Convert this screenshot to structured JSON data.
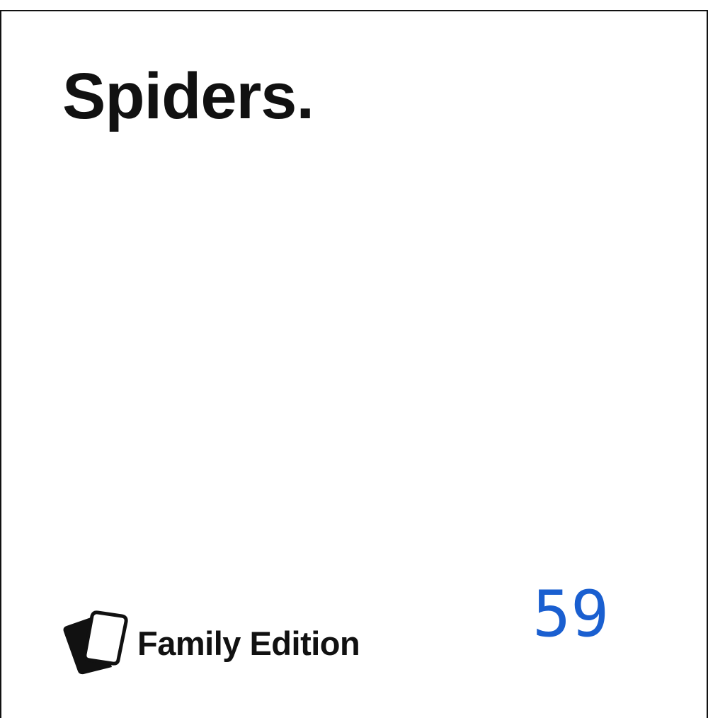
{
  "card": {
    "prompt": "Spiders.",
    "brand": {
      "name": "Family Edition",
      "logo_icon": "cards-stack-icon"
    },
    "number": "59",
    "colors": {
      "text": "#111111",
      "number": "#1a5fd0",
      "background": "#ffffff"
    }
  }
}
